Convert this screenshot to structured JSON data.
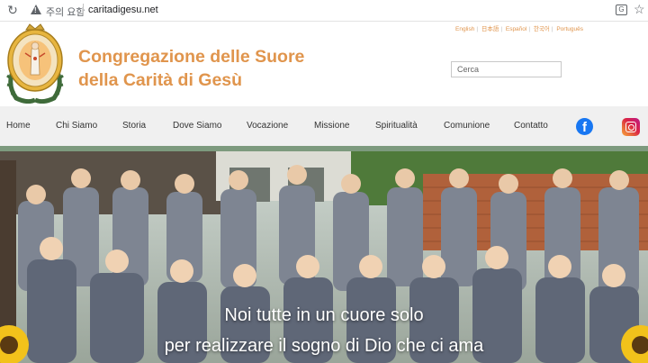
{
  "browser": {
    "security_label": "주의 요함",
    "url": "caritadigesu.net"
  },
  "header": {
    "title_line1": "Congregazione delle Suore",
    "title_line2": "della Carità di Gesù",
    "languages": [
      "English",
      "日本語",
      "Español",
      "한국어",
      "Português"
    ],
    "search_placeholder": "Cerca"
  },
  "nav": {
    "items": [
      "Home",
      "Chi Siamo",
      "Storia",
      "Dove Siamo",
      "Vocazione",
      "Missione",
      "Spiritualità",
      "Comunione",
      "Contatto"
    ]
  },
  "hero": {
    "caption_line1": "Noi tutte in un cuore solo",
    "caption_line2": "per realizzare il sogno di Dio che ci ama"
  },
  "colors": {
    "title_orange": "#e0954d",
    "nav_bg": "#f0f0f0",
    "accent_green": "#7d9a7e",
    "facebook_blue": "#1877f2"
  }
}
